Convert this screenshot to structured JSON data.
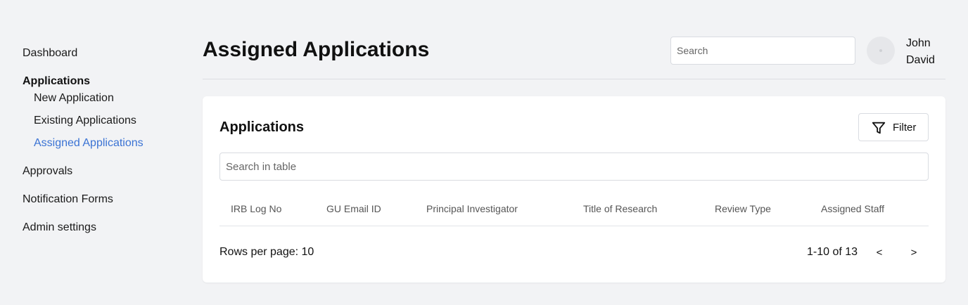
{
  "sidebar": {
    "dashboard": "Dashboard",
    "applications": "Applications",
    "new_application": "New Application",
    "existing_applications": "Existing Applications",
    "assigned_applications": "Assigned Applications",
    "approvals": "Approvals",
    "notification_forms": "Notification Forms",
    "admin_settings": "Admin settings"
  },
  "header": {
    "title": "Assigned Applications",
    "search_placeholder": "Search",
    "user_first": "John",
    "user_last": "David"
  },
  "card": {
    "title": "Applications",
    "filter_label": "Filter",
    "table_search_placeholder": "Search in table",
    "columns": [
      "IRB Log No",
      "GU Email ID",
      "Principal Investigator",
      "Title of Research",
      "Review Type",
      "Assigned Staff"
    ],
    "rows_per_page": "Rows per page: 10",
    "page_range": "1-10 of 13",
    "prev_label": "<",
    "next_label": ">"
  },
  "colors": {
    "accent": "#3b73d4",
    "background": "#f2f3f5"
  }
}
